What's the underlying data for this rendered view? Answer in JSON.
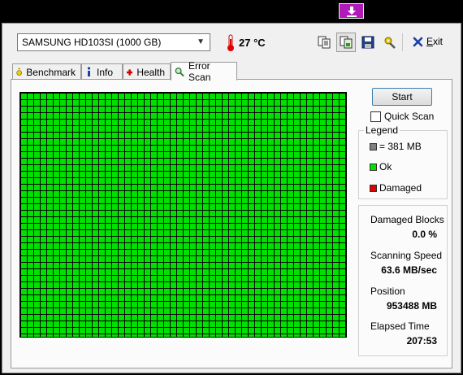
{
  "toolbar": {
    "drive": "SAMSUNG HD103SI (1000 GB)",
    "temperature": "27 °C",
    "exit_label": "Exit",
    "exit_mnemonic": "E",
    "exit_rest": "xit"
  },
  "tabs": [
    {
      "label": "Benchmark",
      "icon": "stopwatch-icon"
    },
    {
      "label": "Info",
      "icon": "info-icon"
    },
    {
      "label": "Health",
      "icon": "health-cross-icon"
    },
    {
      "label": "Error Scan",
      "icon": "magnifier-icon",
      "active": true
    }
  ],
  "scan": {
    "start_label": "Start",
    "quick_scan_label": "Quick Scan",
    "quick_scan_checked": false,
    "block_status": "Ok",
    "block_color": "#00e100"
  },
  "legend": {
    "title": "Legend",
    "items": [
      {
        "label": "= 381 MB",
        "color": "#808080"
      },
      {
        "label": "Ok",
        "color": "#00e100"
      },
      {
        "label": "Damaged",
        "color": "#e00000"
      }
    ]
  },
  "stats": {
    "damaged_blocks_label": "Damaged Blocks",
    "damaged_blocks_value": "0.0 %",
    "speed_label": "Scanning Speed",
    "speed_value": "63.6 MB/sec",
    "position_label": "Position",
    "position_value": "953488 MB",
    "elapsed_label": "Elapsed Time",
    "elapsed_value": "207:53"
  },
  "colors": {
    "accent_titlebar": "#b01ab8",
    "ok": "#00e100",
    "damaged": "#e00000"
  }
}
